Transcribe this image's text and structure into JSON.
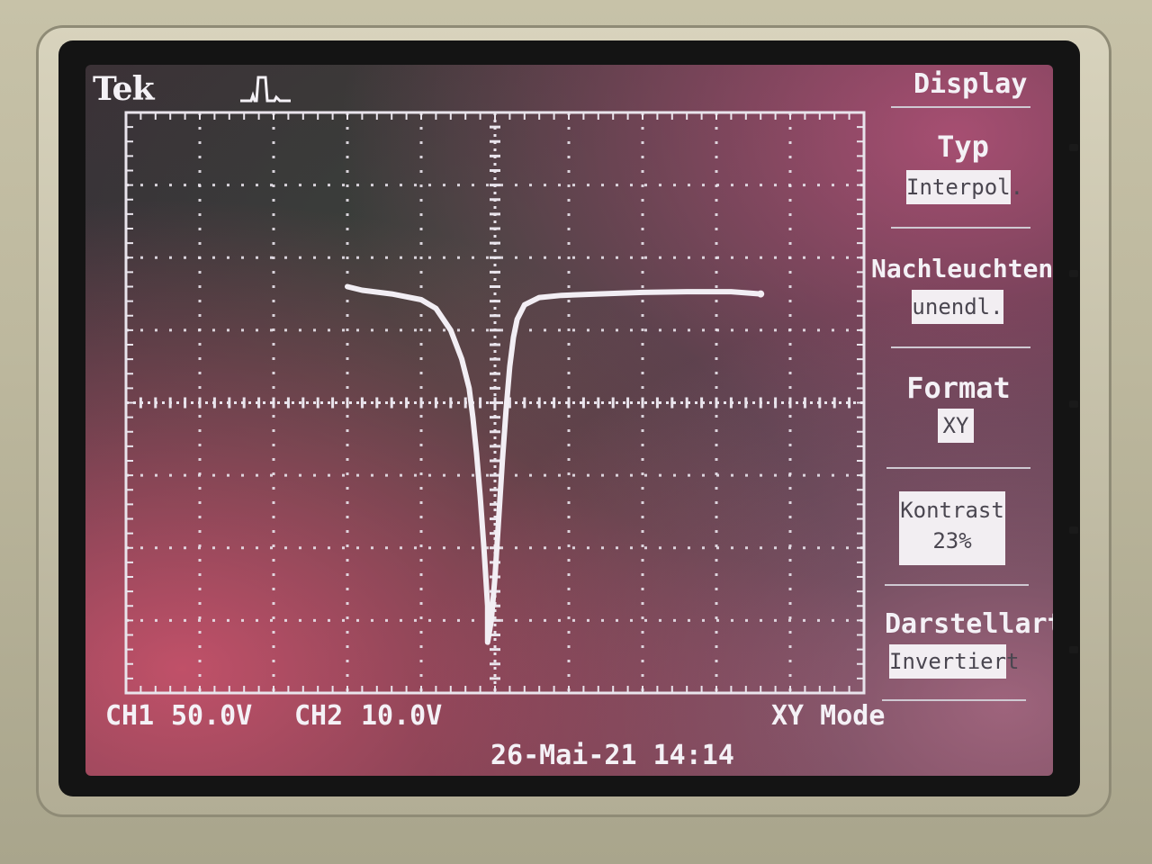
{
  "brand": "Tek",
  "trigger_icon": "trigger-status-icon",
  "menu": {
    "header": "Display",
    "items": [
      {
        "label": "Typ",
        "value": "Interpol."
      },
      {
        "label": "Nachleuchten",
        "value": "unendl."
      },
      {
        "label": "Format",
        "value": "XY"
      },
      {
        "label": "Kontrast",
        "value": "23%"
      },
      {
        "label": "Darstellart",
        "value": "Invertiert"
      }
    ]
  },
  "status": {
    "ch1_label": "CH1",
    "ch1_scale": "50.0V",
    "ch2_label": "CH2",
    "ch2_scale": "10.0V",
    "mode": "XY Mode",
    "timestamp": "26-Mai-21 14:14"
  },
  "colors": {
    "trace": "#f2eef4",
    "screen": "#35303a",
    "accent": "#d35a72"
  },
  "chart_data": {
    "type": "line",
    "title": "",
    "xlabel": "",
    "ylabel": "",
    "xlim": [
      -5,
      5
    ],
    "ylim": [
      -4,
      4
    ],
    "grid": true,
    "x_units": "div",
    "y_units": "div",
    "series": [
      {
        "x": [
          -2.0,
          -1.8,
          -1.4,
          -1.0,
          -0.8,
          -0.6,
          -0.45,
          -0.35,
          -0.3,
          -0.25,
          -0.2,
          -0.15,
          -0.1,
          -0.1,
          -0.05,
          0.0,
          0.05,
          0.1,
          0.15,
          0.2,
          0.25,
          0.3,
          0.4,
          0.6,
          0.9,
          1.4,
          2.0,
          2.6,
          3.2,
          3.6
        ],
        "y": [
          1.6,
          1.55,
          1.5,
          1.42,
          1.3,
          1.0,
          0.6,
          0.2,
          -0.2,
          -0.7,
          -1.3,
          -2.0,
          -2.8,
          -3.3,
          -3.0,
          -2.4,
          -1.6,
          -0.8,
          -0.1,
          0.5,
          0.9,
          1.15,
          1.35,
          1.45,
          1.48,
          1.5,
          1.52,
          1.53,
          1.53,
          1.5
        ]
      }
    ]
  }
}
